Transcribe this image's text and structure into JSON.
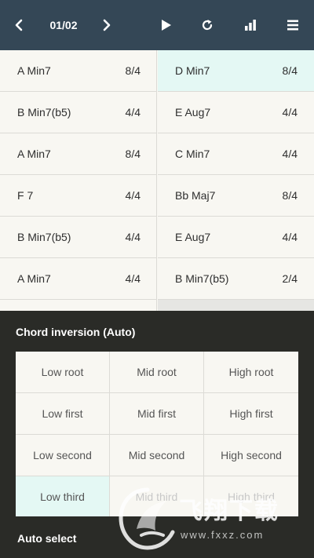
{
  "toolbar": {
    "page_indicator": "01/02",
    "icons": [
      "chevron-left",
      "chevron-right",
      "play",
      "refresh",
      "bar-chart",
      "menu"
    ]
  },
  "chords": {
    "left": [
      {
        "name": "A Min7",
        "beat": "8/4"
      },
      {
        "name": "B Min7(b5)",
        "beat": "4/4"
      },
      {
        "name": "A Min7",
        "beat": "8/4"
      },
      {
        "name": "F 7",
        "beat": "4/4"
      },
      {
        "name": "B Min7(b5)",
        "beat": "4/4"
      },
      {
        "name": "A Min7",
        "beat": "4/4"
      }
    ],
    "right": [
      {
        "name": "D Min7",
        "beat": "8/4",
        "selected": true
      },
      {
        "name": "E Aug7",
        "beat": "4/4"
      },
      {
        "name": "C Min7",
        "beat": "4/4"
      },
      {
        "name": "Bb Maj7",
        "beat": "8/4"
      },
      {
        "name": "E Aug7",
        "beat": "4/4"
      },
      {
        "name": "B Min7(b5)",
        "beat": "2/4"
      }
    ]
  },
  "inversion": {
    "title": "Chord inversion (Auto)",
    "options": [
      [
        "Low root",
        "Mid root",
        "High root"
      ],
      [
        "Low first",
        "Mid first",
        "High first"
      ],
      [
        "Low second",
        "Mid second",
        "High second"
      ],
      [
        "Low third",
        "Mid third",
        "High third"
      ]
    ],
    "selected": "Low third",
    "auto_select_label": "Auto select"
  },
  "watermark": {
    "title": "飞翔下载",
    "url": "www.fxxz.com"
  },
  "colors": {
    "toolbar_bg": "#344756",
    "selected_bg": "#e4f8f4",
    "panel_bg": "#2a2b27"
  }
}
